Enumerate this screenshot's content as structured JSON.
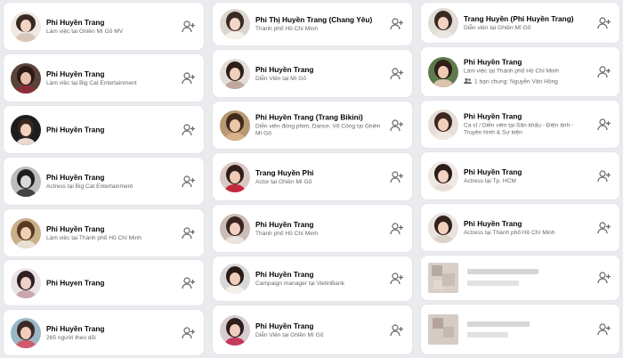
{
  "columns": [
    {
      "cards": [
        {
          "name": "Phi Huyền Trang",
          "subtitle": "Làm việc tại Ghiền Mì Gõ MV"
        },
        {
          "name": "Phi Huyền Trang",
          "subtitle": "Làm việc tại Big Cat Entertainment"
        },
        {
          "name": "Phi Huyền Trang",
          "subtitle": ""
        },
        {
          "name": "Phi Huyền Trang",
          "subtitle": "Actress tại Big Cat Entertainment"
        },
        {
          "name": "Phi Huyền Trang",
          "subtitle": "Làm việc tại Thành phố Hồ Chí Minh"
        },
        {
          "name": "Phi Huyen Trang",
          "subtitle": ""
        },
        {
          "name": "Phi Huyền Trang",
          "subtitle": "265 người theo dõi"
        }
      ]
    },
    {
      "cards": [
        {
          "name": "Phi Thị Huyền Trang (Chang Yêu)",
          "subtitle": "Thành phố Hồ Chí Minh"
        },
        {
          "name": "Phi Huyền Trang",
          "subtitle": "Diễn Viên tại Mì Gõ"
        },
        {
          "name": "Phi Huyền Trang (Trang Bikini)",
          "subtitle": "Diễn viên đóng phim, Dance, Võ Công tại Ghiền Mì Gõ"
        },
        {
          "name": "Trang Huyền Phi",
          "subtitle": "Actor tại Ghiền Mì Gõ"
        },
        {
          "name": "Phi Huyền Trang",
          "subtitle": "Thành phố Hồ Chí Minh"
        },
        {
          "name": "Phi Huyền Trang",
          "subtitle": "Campaign manager tại VietinBank"
        },
        {
          "name": "Phi Huyền Trang",
          "subtitle": "Diễn Viên tại Ghiền Mì Gõ"
        }
      ]
    },
    {
      "cards": [
        {
          "name": "Trang Huyền (Phi Huyền Trang)",
          "subtitle": "Diễn viên tại Ghiền Mì Gõ"
        },
        {
          "name": "Phi Huyền Trang",
          "subtitle": "Làm việc tại Thành phố Hồ Chí Minh",
          "mutual": "1 bạn chung: Nguyễn Văn Hồng"
        },
        {
          "name": "Phi Huyền Trang",
          "subtitle": "Ca sĩ / Diễn viên tại Sân khấu - Điện ảnh - Truyền hình & Sự kiện"
        },
        {
          "name": "Phi Huyền Trang",
          "subtitle": "Actress tại Tp. HCM"
        },
        {
          "name": "Phi Huyền Trang",
          "subtitle": "Actress tại Thành phố Hồ Chí Minh"
        },
        {
          "name": "",
          "subtitle": "",
          "blurred": true
        },
        {
          "name": "",
          "subtitle": "",
          "blurred": true
        }
      ]
    }
  ],
  "icons": {
    "add_friend": "add-friend-icon",
    "mutual_friends": "people-icon",
    "avatar": "profile-photo"
  },
  "colors": {
    "card_bg": "#ffffff",
    "page_bg": "#e9ebee",
    "name": "#050505",
    "secondary": "#65676b"
  }
}
